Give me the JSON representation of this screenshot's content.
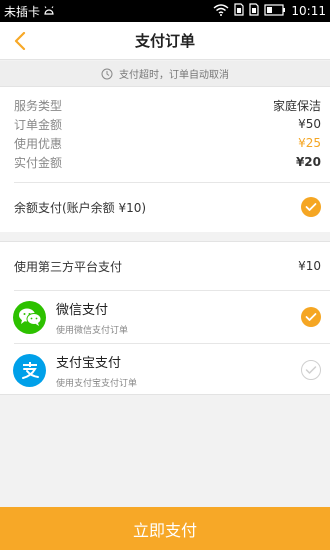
{
  "status_bar": {
    "carrier": "未插卡",
    "time": "10:11"
  },
  "nav": {
    "title": "支付订单"
  },
  "notice": {
    "text": "支付超时，订单自动取消"
  },
  "summary": {
    "rows": [
      {
        "label": "服务类型",
        "value": "家庭保洁"
      },
      {
        "label": "订单金额",
        "value": "¥50"
      },
      {
        "label": "使用优惠",
        "value": "¥25"
      },
      {
        "label": "实付金额",
        "value": "¥20"
      }
    ]
  },
  "balance": {
    "label": "余额支付(账户余额 ¥10)",
    "checked": true
  },
  "third_party": {
    "label": "使用第三方平台支付",
    "amount": "¥10",
    "methods": [
      {
        "name": "微信支付",
        "desc": "使用微信支付订单",
        "icon": "wechat-pay-icon",
        "checked": true
      },
      {
        "name": "支付宝支付",
        "desc": "使用支付宝支付订单",
        "icon": "alipay-icon",
        "checked": false
      }
    ]
  },
  "pay_button": {
    "label": "立即支付"
  },
  "colors": {
    "accent": "#f7a827",
    "wechat": "#2dc100",
    "alipay": "#00a0e9"
  }
}
